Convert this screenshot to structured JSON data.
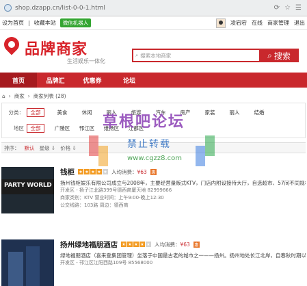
{
  "browser": {
    "url": "shop.dzapp.cn/list-0-0-1.html"
  },
  "topbar": {
    "set_home": "设为首页",
    "bookmark": "收藏本站",
    "wechat": "微信机器人",
    "username": "凌宕宕",
    "online": "在线",
    "shop_admin": "商家管理",
    "logout": "退出"
  },
  "header": {
    "logo_title": "品牌商家",
    "logo_slogan": "生活娱乐一体化",
    "search_placeholder": "搜索本地商家",
    "search_button": "搜索"
  },
  "nav": [
    "首页",
    "品牌汇",
    "优惠券",
    "论坛"
  ],
  "breadcrumb": [
    "商家",
    "商家列表 (28)"
  ],
  "filters": {
    "category_label": "分类：",
    "category_all": "全部",
    "categories": [
      "美食",
      "休闲",
      "丽人",
      "旅游",
      "汽车",
      "房产",
      "家装",
      "丽人",
      "结婚"
    ],
    "area_label": "地区",
    "area_all": "全部",
    "areas": [
      "广陵区",
      "邗江区",
      "维扬区",
      "江都区"
    ]
  },
  "sort": {
    "label": "排序：",
    "default": "默认",
    "stars": "星级",
    "price": "价格"
  },
  "listings": [
    {
      "name": "钱柜",
      "stars": 4,
      "avg_label": "人均消费：",
      "avg_price": "¥63",
      "thumb_text": "PARTY WORLD",
      "desc": "扬州钱柜娱乐有限公司成立与2008年，主要经营量贩式KTV，门店内附设接待大厅，自选超市、57间不同规格的包",
      "addr": "开发区 - 扬子江北路399号德西商厦天地   82999666",
      "type": "商家类别：KTV   营业时间：上午9:00-晚上12:30",
      "traffic": "公交线路：103路     周边：德西商"
    },
    {
      "name": "扬州绿地福朋酒店",
      "stars": 4,
      "avg_label": "人均消费：",
      "avg_price": "¥63",
      "thumb_text": "",
      "desc": "绿地福朋酒店（喜来登集团管理）坐落于中国最古老的城市之一——扬州。扬州地处长江北岸，自春秋时期以来一",
      "addr": "开发区 - 邗江区江阳西路109号   85568000",
      "type": "",
      "traffic": ""
    }
  ],
  "watermark": {
    "line1": "草根吧论坛",
    "line2": "禁止转载",
    "line3": "www.cgzz8.com"
  }
}
